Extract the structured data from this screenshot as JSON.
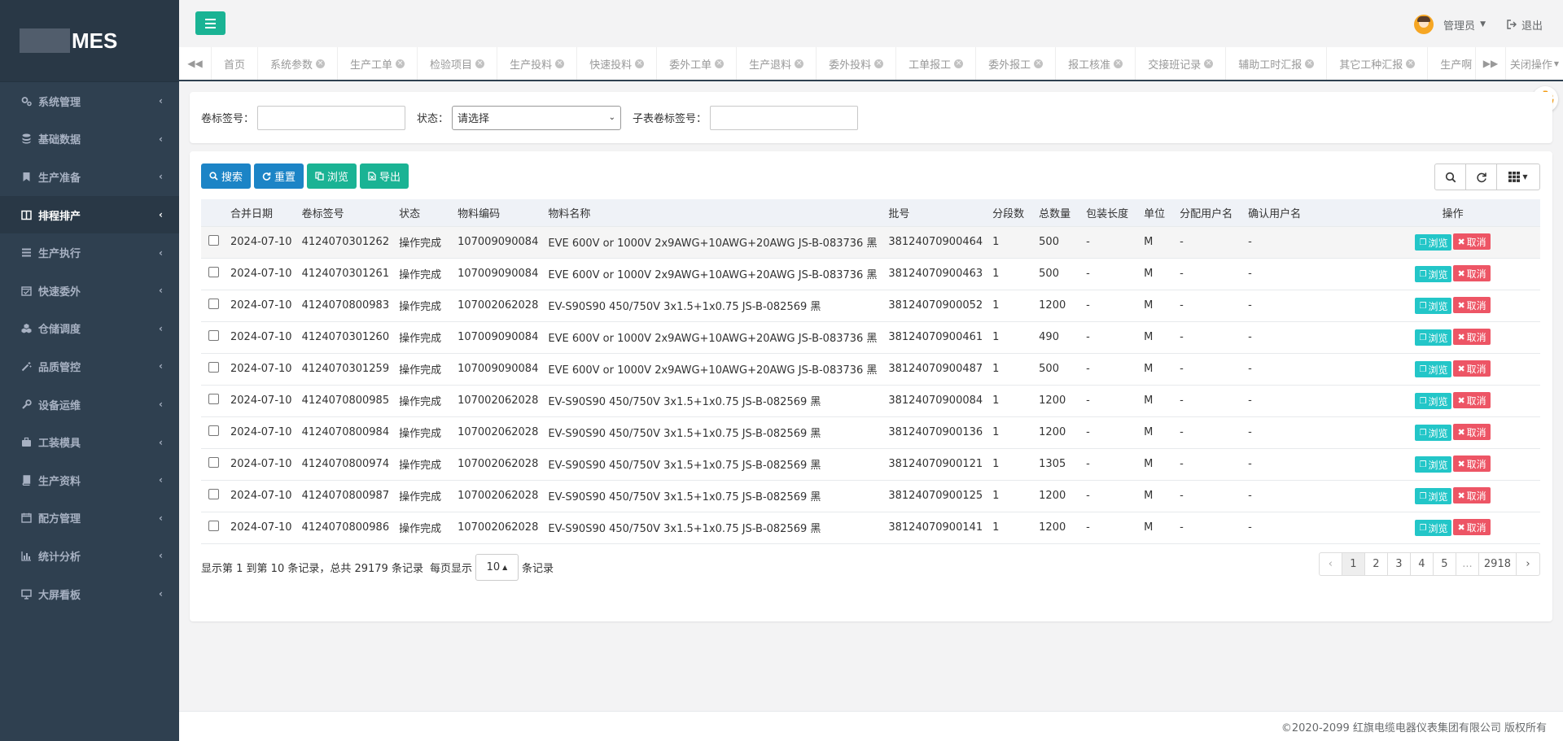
{
  "app": {
    "logo_text": "MES",
    "copyright": "©2020-2099 红旗电缆电器仪表集团有限公司 版权所有"
  },
  "sidebar": {
    "items": [
      {
        "label": "系统管理",
        "icon": "gears-icon"
      },
      {
        "label": "基础数据",
        "icon": "database-icon"
      },
      {
        "label": "生产准备",
        "icon": "bookmark-icon"
      },
      {
        "label": "排程排产",
        "icon": "columns-icon",
        "active": true
      },
      {
        "label": "生产执行",
        "icon": "list-icon"
      },
      {
        "label": "快速委外",
        "icon": "calendar-check-icon"
      },
      {
        "label": "仓储调度",
        "icon": "cubes-icon"
      },
      {
        "label": "品质管控",
        "icon": "magic-icon"
      },
      {
        "label": "设备运维",
        "icon": "wrench-icon"
      },
      {
        "label": "工装模具",
        "icon": "briefcase-icon"
      },
      {
        "label": "生产资料",
        "icon": "book-icon"
      },
      {
        "label": "配方管理",
        "icon": "calendar-icon"
      },
      {
        "label": "统计分析",
        "icon": "bar-chart-icon"
      },
      {
        "label": "大屏看板",
        "icon": "desktop-icon"
      }
    ]
  },
  "header": {
    "user_name": "管理员",
    "logout_label": "退出"
  },
  "tabs": {
    "items": [
      {
        "label": "首页",
        "closable": false
      },
      {
        "label": "系统参数",
        "closable": true
      },
      {
        "label": "生产工单",
        "closable": true
      },
      {
        "label": "检验项目",
        "closable": true
      },
      {
        "label": "生产投料",
        "closable": true
      },
      {
        "label": "快速投料",
        "closable": true
      },
      {
        "label": "委外工单",
        "closable": true
      },
      {
        "label": "生产退料",
        "closable": true
      },
      {
        "label": "委外投料",
        "closable": true
      },
      {
        "label": "工单报工",
        "closable": true
      },
      {
        "label": "委外报工",
        "closable": true
      },
      {
        "label": "报工核准",
        "closable": true
      },
      {
        "label": "交接班记录",
        "closable": true
      },
      {
        "label": "辅助工时汇报",
        "closable": true
      },
      {
        "label": "其它工种汇报",
        "closable": true
      },
      {
        "label": "生产啊",
        "closable": true
      }
    ],
    "close_ops_label": "关闭操作"
  },
  "search": {
    "reel_label": "卷标签号：",
    "status_label": "状态：",
    "status_value": "请选择",
    "child_reel_label": "子表卷标签号："
  },
  "toolbar": {
    "search_label": "搜索",
    "reset_label": "重置",
    "browse_label": "浏览",
    "export_label": "导出"
  },
  "table": {
    "headers": [
      "合并日期",
      "卷标签号",
      "状态",
      "物料编码",
      "物料名称",
      "批号",
      "分段数",
      "总数量",
      "包装长度",
      "单位",
      "分配用户名",
      "确认用户名",
      "操作"
    ],
    "view_label": "浏览",
    "cancel_label": "取消",
    "rows": [
      [
        "2024-07-10",
        "4124070301262",
        "操作完成",
        "107009090084",
        "EVE 600V or 1000V 2x9AWG+10AWG+20AWG JS-B-083736 黑",
        "38124070900464",
        "1",
        "500",
        "-",
        "M",
        "-",
        "-"
      ],
      [
        "2024-07-10",
        "4124070301261",
        "操作完成",
        "107009090084",
        "EVE 600V or 1000V 2x9AWG+10AWG+20AWG JS-B-083736 黑",
        "38124070900463",
        "1",
        "500",
        "-",
        "M",
        "-",
        "-"
      ],
      [
        "2024-07-10",
        "4124070800983",
        "操作完成",
        "107002062028",
        "EV-S90S90 450/750V 3x1.5+1x0.75 JS-B-082569 黑",
        "38124070900052",
        "1",
        "1200",
        "-",
        "M",
        "-",
        "-"
      ],
      [
        "2024-07-10",
        "4124070301260",
        "操作完成",
        "107009090084",
        "EVE 600V or 1000V 2x9AWG+10AWG+20AWG JS-B-083736 黑",
        "38124070900461",
        "1",
        "490",
        "-",
        "M",
        "-",
        "-"
      ],
      [
        "2024-07-10",
        "4124070301259",
        "操作完成",
        "107009090084",
        "EVE 600V or 1000V 2x9AWG+10AWG+20AWG JS-B-083736 黑",
        "38124070900487",
        "1",
        "500",
        "-",
        "M",
        "-",
        "-"
      ],
      [
        "2024-07-10",
        "4124070800985",
        "操作完成",
        "107002062028",
        "EV-S90S90 450/750V 3x1.5+1x0.75 JS-B-082569 黑",
        "38124070900084",
        "1",
        "1200",
        "-",
        "M",
        "-",
        "-"
      ],
      [
        "2024-07-10",
        "4124070800984",
        "操作完成",
        "107002062028",
        "EV-S90S90 450/750V 3x1.5+1x0.75 JS-B-082569 黑",
        "38124070900136",
        "1",
        "1200",
        "-",
        "M",
        "-",
        "-"
      ],
      [
        "2024-07-10",
        "4124070800974",
        "操作完成",
        "107002062028",
        "EV-S90S90 450/750V 3x1.5+1x0.75 JS-B-082569 黑",
        "38124070900121",
        "1",
        "1305",
        "-",
        "M",
        "-",
        "-"
      ],
      [
        "2024-07-10",
        "4124070800987",
        "操作完成",
        "107002062028",
        "EV-S90S90 450/750V 3x1.5+1x0.75 JS-B-082569 黑",
        "38124070900125",
        "1",
        "1200",
        "-",
        "M",
        "-",
        "-"
      ],
      [
        "2024-07-10",
        "4124070800986",
        "操作完成",
        "107002062028",
        "EV-S90S90 450/750V 3x1.5+1x0.75 JS-B-082569 黑",
        "38124070900141",
        "1",
        "1200",
        "-",
        "M",
        "-",
        "-"
      ]
    ]
  },
  "pager": {
    "info_text": "显示第 1 到第 10 条记录，总共 29179 条记录",
    "per_page_prefix": "每页显示",
    "page_size": "10",
    "per_page_suffix": "条记录",
    "prev": "‹",
    "next": "›",
    "pages": [
      "1",
      "2",
      "3",
      "4",
      "5",
      "...",
      "2918"
    ],
    "active_page": "1"
  },
  "colors": {
    "sidebar_bg": "#2f4050",
    "primary": "#1c84c6",
    "success": "#1ab394",
    "info": "#23c6c8",
    "danger": "#ed5565"
  }
}
